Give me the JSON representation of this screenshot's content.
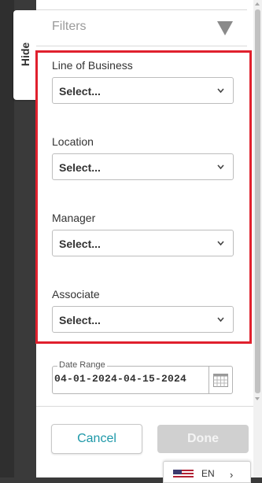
{
  "side_tab": {
    "label": "Hide"
  },
  "panel": {
    "title": "Filters",
    "filter_icon": "funnel-icon"
  },
  "filters": [
    {
      "label": "Line of Business",
      "value": "Select..."
    },
    {
      "label": "Location",
      "value": "Select..."
    },
    {
      "label": "Manager",
      "value": "Select..."
    },
    {
      "label": "Associate",
      "value": "Select..."
    }
  ],
  "date_range": {
    "legend": "Date Range",
    "value": "04-01-2024-04-15-2024",
    "icon": "calendar-icon"
  },
  "actions": {
    "cancel_label": "Cancel",
    "done_label": "Done"
  },
  "language": {
    "code": "EN",
    "flag_icon": "us-flag-icon"
  },
  "colors": {
    "accent": "#1d98a8",
    "highlight": "#e0202d",
    "disabled": "#d0d0d0"
  }
}
